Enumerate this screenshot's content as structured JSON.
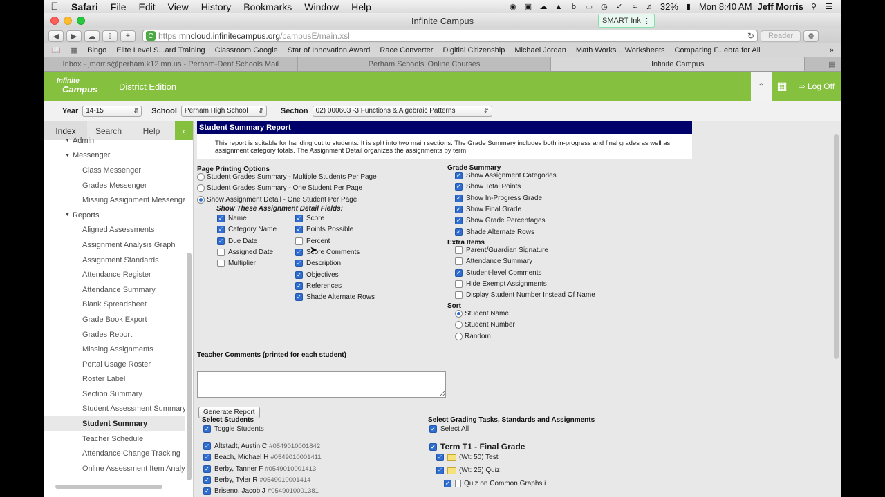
{
  "menubar": {
    "app": "Safari",
    "items": [
      "File",
      "Edit",
      "View",
      "History",
      "Bookmarks",
      "Window",
      "Help"
    ],
    "battery": "32%",
    "clock": "Mon 8:40 AM",
    "user": "Jeff Morris"
  },
  "window": {
    "title": "Infinite Campus",
    "smart_ink": "SMART Ink"
  },
  "toolbar": {
    "url_protocol": "https",
    "url_host": "mncloud.infinitecampus.org",
    "url_path": "/campusE/main.xsl",
    "reader": "Reader"
  },
  "bookmarks": [
    "Bingo",
    "Elite Level S...ard Training",
    "Classroom Google",
    "Star of Innovation Award",
    "Race Converter",
    "Digitial Citizenship",
    "Michael Jordan",
    "Math Works... Worksheets",
    "Comparing F...ebra for All"
  ],
  "tabs": [
    {
      "label": "Inbox - jmorris@perham.k12.mn.us - Perham-Dent Schools Mail"
    },
    {
      "label": "Perham Schools' Online Courses"
    },
    {
      "label": "Infinite Campus"
    }
  ],
  "header": {
    "logo_line1": "Infinite",
    "logo_line2": "Campus",
    "edition": "District Edition",
    "logoff": "Log Off"
  },
  "selectors": {
    "year_label": "Year",
    "year_value": "14-15",
    "school_label": "School",
    "school_value": "Perham High School",
    "section_label": "Section",
    "section_value": "02) 000603 -3 Functions & Algebraic Patterns"
  },
  "left_tabs": [
    "Index",
    "Search",
    "Help"
  ],
  "tree": [
    {
      "label": "Admin",
      "type": "grp"
    },
    {
      "label": "Messenger",
      "type": "grp"
    },
    {
      "label": "Class Messenger",
      "type": "leaf"
    },
    {
      "label": "Grades Messenger",
      "type": "leaf"
    },
    {
      "label": "Missing Assignment Messenger",
      "type": "leaf"
    },
    {
      "label": "Reports",
      "type": "grp"
    },
    {
      "label": "Aligned Assessments",
      "type": "leaf"
    },
    {
      "label": "Assignment Analysis Graph",
      "type": "leaf"
    },
    {
      "label": "Assignment Standards",
      "type": "leaf"
    },
    {
      "label": "Attendance Register",
      "type": "leaf"
    },
    {
      "label": "Attendance Summary",
      "type": "leaf"
    },
    {
      "label": "Blank Spreadsheet",
      "type": "leaf"
    },
    {
      "label": "Grade Book Export",
      "type": "leaf"
    },
    {
      "label": "Grades Report",
      "type": "leaf"
    },
    {
      "label": "Missing Assignments",
      "type": "leaf"
    },
    {
      "label": "Portal Usage Roster",
      "type": "leaf"
    },
    {
      "label": "Roster Label",
      "type": "leaf"
    },
    {
      "label": "Section Summary",
      "type": "leaf"
    },
    {
      "label": "Student Assessment Summary",
      "type": "leaf"
    },
    {
      "label": "Student Summary",
      "type": "leaf",
      "selected": true
    },
    {
      "label": "Teacher Schedule",
      "type": "leaf"
    },
    {
      "label": "Attendance Change Tracking",
      "type": "leaf"
    },
    {
      "label": "Online Assessment Item Analysis",
      "type": "leaf"
    }
  ],
  "report": {
    "title": "Student Summary Report",
    "description": "This report is suitable for handing out to students. It is split into two main sections. The Grade Summary includes both in-progress and final grades as well as assignment category totals. The Assignment Detail organizes the assignments by term.",
    "page_printing_title": "Page Printing Options",
    "print_options": [
      {
        "label": "Student Grades Summary - Multiple Students Per Page",
        "checked": false
      },
      {
        "label": "Student Grades Summary - One Student Per Page",
        "checked": false
      },
      {
        "label": "Show Assignment Detail - One Student Per Page",
        "checked": true
      }
    ],
    "detail_fields_title": "Show These Assignment Detail Fields:",
    "detail_col1": [
      {
        "label": "Name",
        "checked": true
      },
      {
        "label": "Category Name",
        "checked": true
      },
      {
        "label": "Due Date",
        "checked": true
      },
      {
        "label": "Assigned Date",
        "checked": false
      },
      {
        "label": "Multiplier",
        "checked": false
      }
    ],
    "detail_col2": [
      {
        "label": "Score",
        "checked": true
      },
      {
        "label": "Points Possible",
        "checked": true
      },
      {
        "label": "Percent",
        "checked": false
      },
      {
        "label": "Score Comments",
        "checked": true
      },
      {
        "label": "Description",
        "checked": true
      },
      {
        "label": "Objectives",
        "checked": true
      },
      {
        "label": "References",
        "checked": true
      },
      {
        "label": "Shade Alternate Rows",
        "checked": true
      }
    ],
    "grade_summary_title": "Grade Summary",
    "grade_summary": [
      {
        "label": "Show Assignment Categories",
        "checked": true
      },
      {
        "label": "Show Total Points",
        "checked": true
      },
      {
        "label": "Show In-Progress Grade",
        "checked": true
      },
      {
        "label": "Show Final Grade",
        "checked": true
      },
      {
        "label": "Show Grade Percentages",
        "checked": true
      },
      {
        "label": "Shade Alternate Rows",
        "checked": true
      }
    ],
    "extra_title": "Extra Items",
    "extra": [
      {
        "label": "Parent/Guardian Signature",
        "checked": false
      },
      {
        "label": "Attendance Summary",
        "checked": false
      },
      {
        "label": "Student-level Comments",
        "checked": true
      },
      {
        "label": "Hide Exempt Assignments",
        "checked": false
      },
      {
        "label": "Display Student Number Instead Of Name",
        "checked": false
      }
    ],
    "sort_title": "Sort",
    "sort": [
      {
        "label": "Student Name",
        "checked": true
      },
      {
        "label": "Student Number",
        "checked": false
      },
      {
        "label": "Random",
        "checked": false
      }
    ],
    "teacher_comments_label": "Teacher Comments (printed for each student)",
    "generate_button": "Generate Report",
    "select_students_title": "Select Students",
    "toggle_students": "Toggle Students",
    "students": [
      {
        "name": "Altstadt, Austin C",
        "id": "#0549010001842"
      },
      {
        "name": "Beach, Michael H",
        "id": "#0549010001411"
      },
      {
        "name": "Berby, Tanner F",
        "id": "#0549010001413"
      },
      {
        "name": "Berby, Tyler R",
        "id": "#0549010001414"
      },
      {
        "name": "Briseno, Jacob J",
        "id": "#0549010001381"
      }
    ],
    "select_tasks_title": "Select Grading Tasks, Standards and Assignments",
    "select_all": "Select All",
    "term_label": "Term T1 - Final Grade",
    "task_items": [
      {
        "label": "(Wt: 50) Test",
        "kind": "folder"
      },
      {
        "label": "(Wt: 25) Quiz",
        "kind": "folder"
      },
      {
        "label": "Quiz on Common Graphs i",
        "kind": "doc"
      }
    ]
  }
}
